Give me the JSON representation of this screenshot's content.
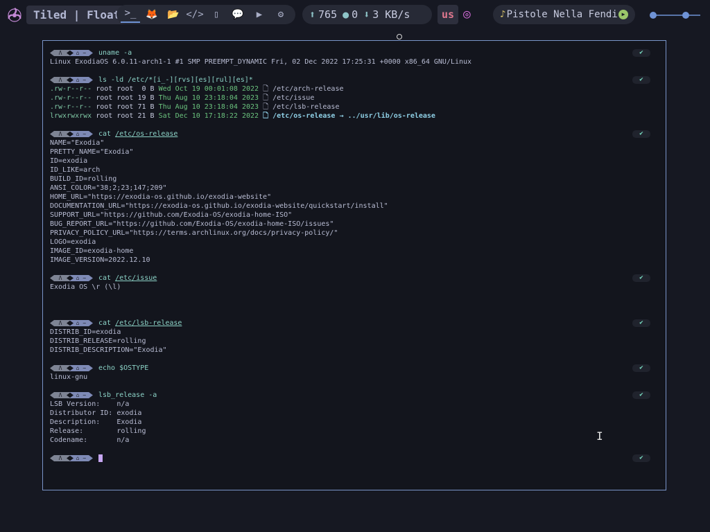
{
  "topbar": {
    "mode_label": "Tiled | Float",
    "apps": [
      {
        "name": "terminal-icon",
        "glyph": ">_"
      },
      {
        "name": "firefox-icon",
        "glyph": "🦊"
      },
      {
        "name": "folder-icon",
        "glyph": "📂"
      },
      {
        "name": "code-icon",
        "glyph": "</>"
      },
      {
        "name": "office-icon",
        "glyph": "▯"
      },
      {
        "name": "chat-icon",
        "glyph": "💬"
      },
      {
        "name": "youtube-icon",
        "glyph": "▶"
      },
      {
        "name": "settings-icon",
        "glyph": "⚙"
      }
    ],
    "updates": "765",
    "github": "0",
    "net": "3 KB/s",
    "kbd_layout": "us",
    "music_title": "Pistole Nella Fendi"
  },
  "terminal": {
    "prompt_home": "⌂ ~",
    "prompt_os": "Λ",
    "check": "✔",
    "blocks": [
      {
        "cmd": "uname -a",
        "lines": [
          "Linux ExodiaOS 6.0.11-arch1-1 #1 SMP PREEMPT_DYNAMIC Fri, 02 Dec 2022 17:25:31 +0000 x86_64 GNU/Linux"
        ]
      },
      {
        "cmd": "ls -ld /etc/*[i_-][rvs][es][rul][es]*",
        "ls": [
          {
            "perm": ".rw-r--r--",
            "owner": "root root",
            "size": " 0 B",
            "date": "Wed Oct 19 00:01:08 2022",
            "file": "/etc/arch-release"
          },
          {
            "perm": ".rw-r--r--",
            "owner": "root root",
            "size": "19 B",
            "date": "Thu Aug 10 23:18:04 2023",
            "file": "/etc/issue"
          },
          {
            "perm": ".rw-r--r--",
            "owner": "root root",
            "size": "71 B",
            "date": "Thu Aug 10 23:18:04 2023",
            "file": "/etc/lsb-release"
          },
          {
            "perm": "lrwxrwxrwx",
            "owner": "root root",
            "size": "21 B",
            "date": "Sat Dec 10 17:18:22 2022",
            "file": "/etc/os-release → ../usr/lib/os-release",
            "link": true
          }
        ]
      },
      {
        "cmd": "cat",
        "arg": "/etc/os-release",
        "lines": [
          "NAME=\"Exodia\"",
          "PRETTY_NAME=\"Exodia\"",
          "ID=exodia",
          "ID_LIKE=arch",
          "BUILD_ID=rolling",
          "ANSI_COLOR=\"38;2;23;147;209\"",
          "HOME_URL=\"https://exodia-os.github.io/exodia-website\"",
          "DOCUMENTATION_URL=\"https://exodia-os.github.io/exodia-website/quickstart/install\"",
          "SUPPORT_URL=\"https://github.com/Exodia-OS/exodia-home-ISO\"",
          "BUG_REPORT_URL=\"https://github.com/Exodia-OS/exodia-home-ISO/issues\"",
          "PRIVACY_POLICY_URL=\"https://terms.archlinux.org/docs/privacy-policy/\"",
          "LOGO=exodia",
          "IMAGE_ID=exodia-home",
          "IMAGE_VERSION=2022.12.10"
        ]
      },
      {
        "cmd": "cat",
        "arg": "/etc/issue",
        "lines": [
          "Exodia OS \\r (\\l)",
          "",
          ""
        ]
      },
      {
        "cmd": "cat",
        "arg": "/etc/lsb-release",
        "lines": [
          "DISTRIB_ID=exodia",
          "DISTRIB_RELEASE=rolling",
          "DISTRIB_DESCRIPTION=\"Exodia\""
        ]
      },
      {
        "cmd": "echo $OSTYPE",
        "lines": [
          "linux-gnu"
        ]
      },
      {
        "cmd": "lsb_release -a",
        "lines": [
          "LSB Version:    n/a",
          "Distributor ID: exodia",
          "Description:    Exodia",
          "Release:        rolling",
          "Codename:       n/a"
        ]
      }
    ]
  },
  "colors": {
    "accent": "#7a95c9",
    "prompt_cmd": "#8cd3c7",
    "bg": "#161822"
  }
}
